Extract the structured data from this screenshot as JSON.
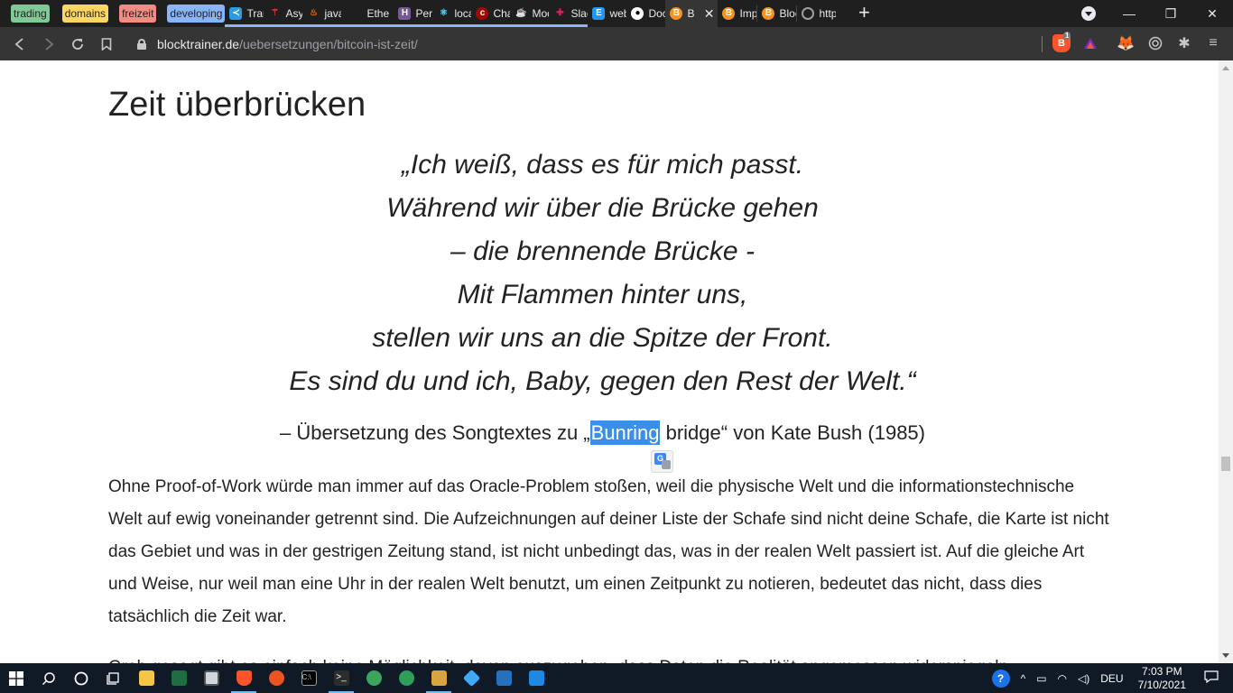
{
  "tab_groups": [
    "trading",
    "domains",
    "freizeit",
    "developing"
  ],
  "tabs": [
    {
      "label": "Trans",
      "icon": "vscode-icon",
      "color": "#2b9ae0"
    },
    {
      "label": "Asyn",
      "icon": "async-icon",
      "color": "#e53935"
    },
    {
      "label": "javas",
      "icon": "java-icon",
      "color": "#e76f00"
    },
    {
      "label": "Ethe",
      "icon": "blank-icon",
      "color": "#1f1f1f"
    },
    {
      "label": "Pers",
      "icon": "heroku-icon",
      "color": "#79589f"
    },
    {
      "label": "local",
      "icon": "react-icon",
      "color": "#61dafb"
    },
    {
      "label": "Chai",
      "icon": "chai-icon",
      "color": "#a30701"
    },
    {
      "label": "Moc",
      "icon": "mocha-icon",
      "color": "#8d6748"
    },
    {
      "label": "Slack",
      "icon": "slack-icon",
      "color": "#e01e5a"
    },
    {
      "label": "web",
      "icon": "web-icon",
      "color": "#2196f3"
    },
    {
      "label": "Docu",
      "icon": "github-icon",
      "color": "#ffffff"
    },
    {
      "label": "B",
      "icon": "bitcoin-icon",
      "color": "#f7931a"
    },
    {
      "label": "Imp",
      "icon": "bitcoin-icon",
      "color": "#f7931a"
    },
    {
      "label": "Block",
      "icon": "bitcoin-icon",
      "color": "#f7931a"
    },
    {
      "label": "http",
      "icon": "globe-icon",
      "color": "#9aa0a6"
    }
  ],
  "address": {
    "host": "blocktrainer.de",
    "path": "/uebersetzungen/bitcoin-ist-zeit/"
  },
  "brave_badge": "1",
  "article": {
    "heading": "Zeit überbrücken",
    "quote_lines": [
      "„Ich weiß, dass es für mich passt.",
      "Während wir über die Brücke gehen",
      "– die brennende Brücke -",
      "Mit Flammen hinter uns,",
      "stellen wir uns an die Spitze der Front.",
      "Es sind du und ich, Baby, gegen den Rest der Welt.“"
    ],
    "cite_before": "– Übersetzung des Songtextes zu „",
    "cite_selected": "Bunring",
    "cite_after": " bridge“ von Kate Bush (1985)",
    "paragraph": "Ohne Proof-of-Work würde man immer auf das Oracle-Problem stoßen, weil die physische Welt und die informationstechnische Welt auf ewig voneinander getrennt sind. Die Aufzeichnungen auf deiner Liste der Schafe sind nicht deine Schafe, die Karte ist nicht das Gebiet und was in der gestrigen Zeitung stand, ist nicht unbedingt das, was in der realen Welt passiert ist. Auf die gleiche Art und Weise, nur weil man eine Uhr in der realen Welt benutzt, um einen Zeitpunkt zu notieren, bedeutet das nicht, dass dies tatsächlich die Zeit war.",
    "paragraph2_partial": "Grob gesagt gibt es einfach keine Möglichkeit, davon auszugehen, dass Daten die Realität angemessen widerspiegeln"
  },
  "taskbar": {
    "language": "DEU",
    "time": "7:03 PM",
    "date": "7/10/2021"
  }
}
